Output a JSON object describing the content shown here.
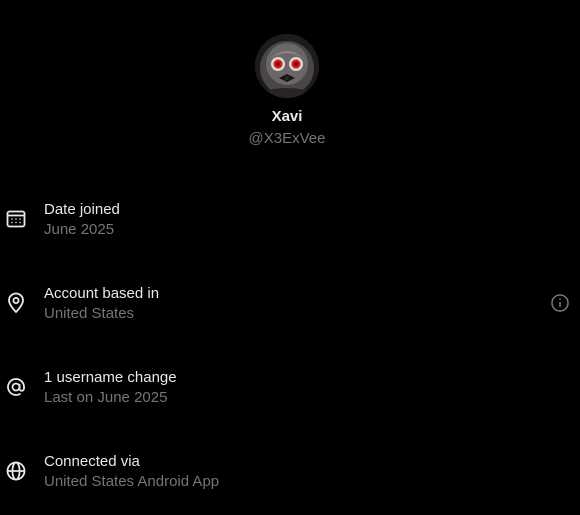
{
  "profile": {
    "display_name": "Xavi",
    "handle": "@X3ExVee",
    "avatar_icon": "avatar-image"
  },
  "rows": [
    {
      "icon": "calendar-icon",
      "title": "Date joined",
      "subtitle": "June 2025"
    },
    {
      "icon": "location-pin-icon",
      "title": "Account based in",
      "subtitle": "United States"
    },
    {
      "icon": "at-sign-icon",
      "title": "1 username change",
      "subtitle": "Last on June 2025"
    },
    {
      "icon": "globe-icon",
      "title": "Connected via",
      "subtitle": "United States Android App"
    }
  ],
  "info_button_icon": "info-icon",
  "colors": {
    "background": "#000000",
    "primary_text": "#e7e9ea",
    "secondary_text": "#71767b"
  }
}
